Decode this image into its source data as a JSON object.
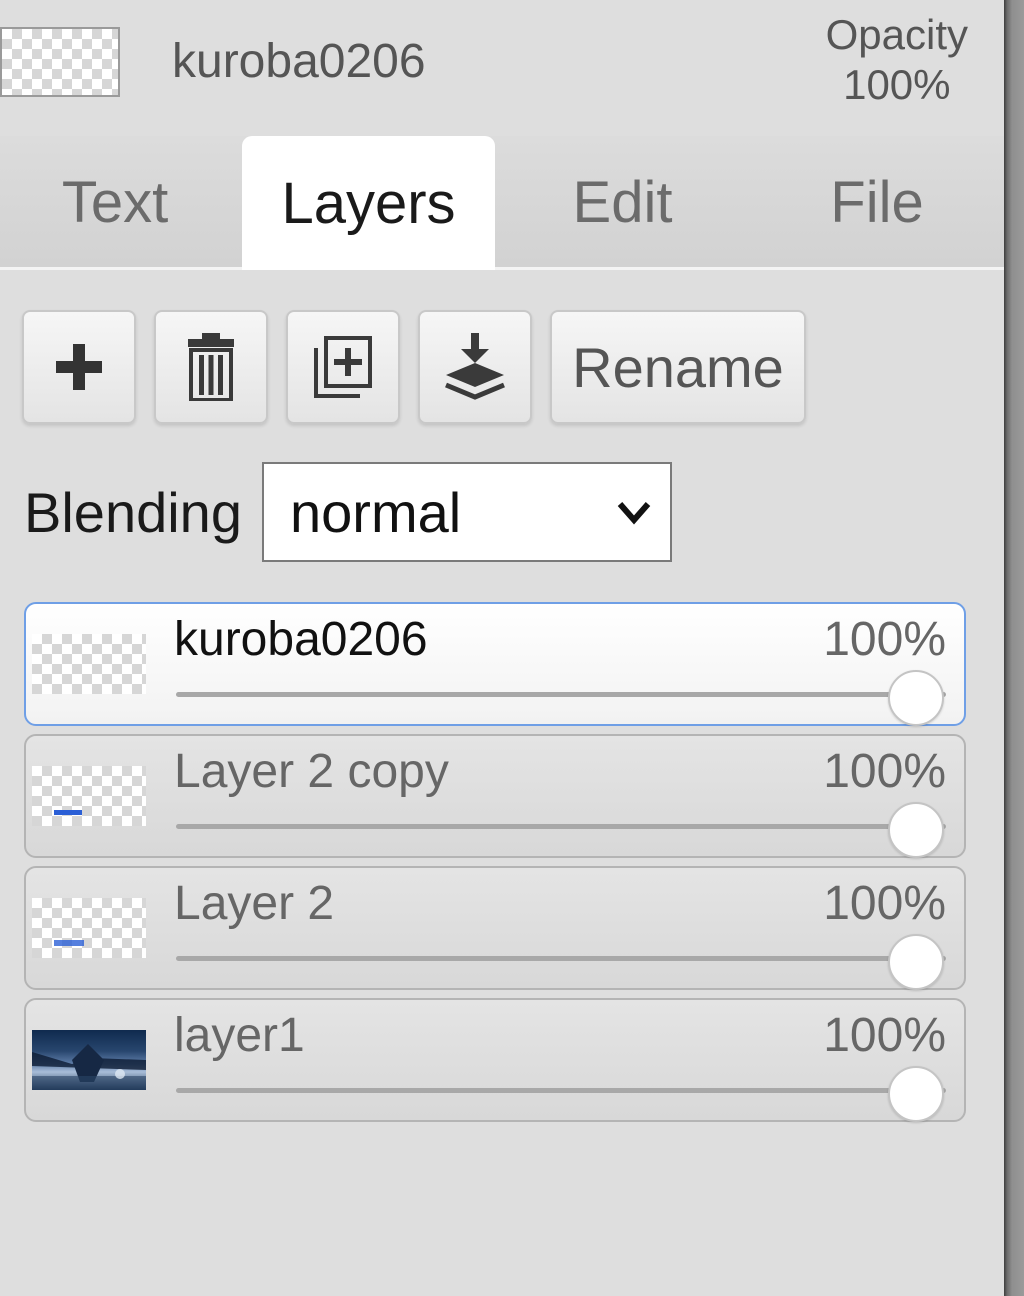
{
  "header": {
    "layer_name": "kuroba0206",
    "opacity_label": "Opacity",
    "opacity_value": "100%"
  },
  "tabs": [
    {
      "label": "Text",
      "active": false
    },
    {
      "label": "Layers",
      "active": true
    },
    {
      "label": "Edit",
      "active": false
    },
    {
      "label": "File",
      "active": false
    }
  ],
  "toolbar": {
    "add_icon": "plus-icon",
    "delete_icon": "trash-icon",
    "duplicate_icon": "duplicate-icon",
    "merge_icon": "merge-down-icon",
    "rename_label": "Rename"
  },
  "blending": {
    "label": "Blending",
    "selected": "normal"
  },
  "layers": [
    {
      "name": "kuroba0206",
      "opacity_label": "100%",
      "opacity": 100,
      "selected": true
    },
    {
      "name": "Layer 2 copy",
      "opacity_label": "100%",
      "opacity": 100,
      "selected": false
    },
    {
      "name": "Layer 2",
      "opacity_label": "100%",
      "opacity": 100,
      "selected": false
    },
    {
      "name": "layer1",
      "opacity_label": "100%",
      "opacity": 100,
      "selected": false
    }
  ],
  "colors": {
    "selection_border": "#6f9fe6",
    "panel_bg": "#dedede"
  }
}
